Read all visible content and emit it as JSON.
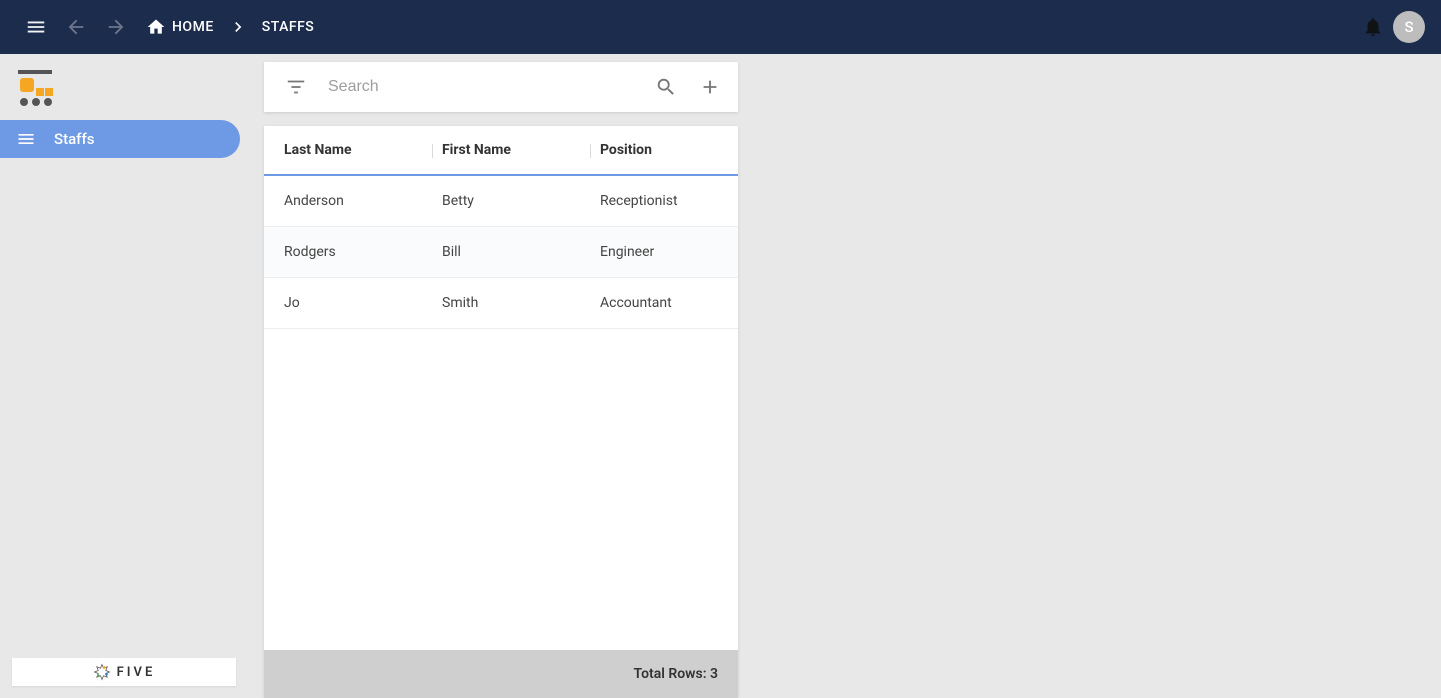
{
  "header": {
    "home_label": "HOME",
    "crumb_label": "STAFFS",
    "avatar_initial": "S"
  },
  "sidebar": {
    "items": [
      {
        "label": "Staffs"
      }
    ],
    "brand": "FIVE"
  },
  "search": {
    "placeholder": "Search"
  },
  "table": {
    "columns": [
      "Last Name",
      "First Name",
      "Position"
    ],
    "rows": [
      {
        "last": "Anderson",
        "first": "Betty",
        "position": "Receptionist"
      },
      {
        "last": "Rodgers",
        "first": "Bill",
        "position": "Engineer"
      },
      {
        "last": "Jo",
        "first": "Smith",
        "position": "Accountant"
      }
    ],
    "footer_label": "Total Rows: 3"
  }
}
